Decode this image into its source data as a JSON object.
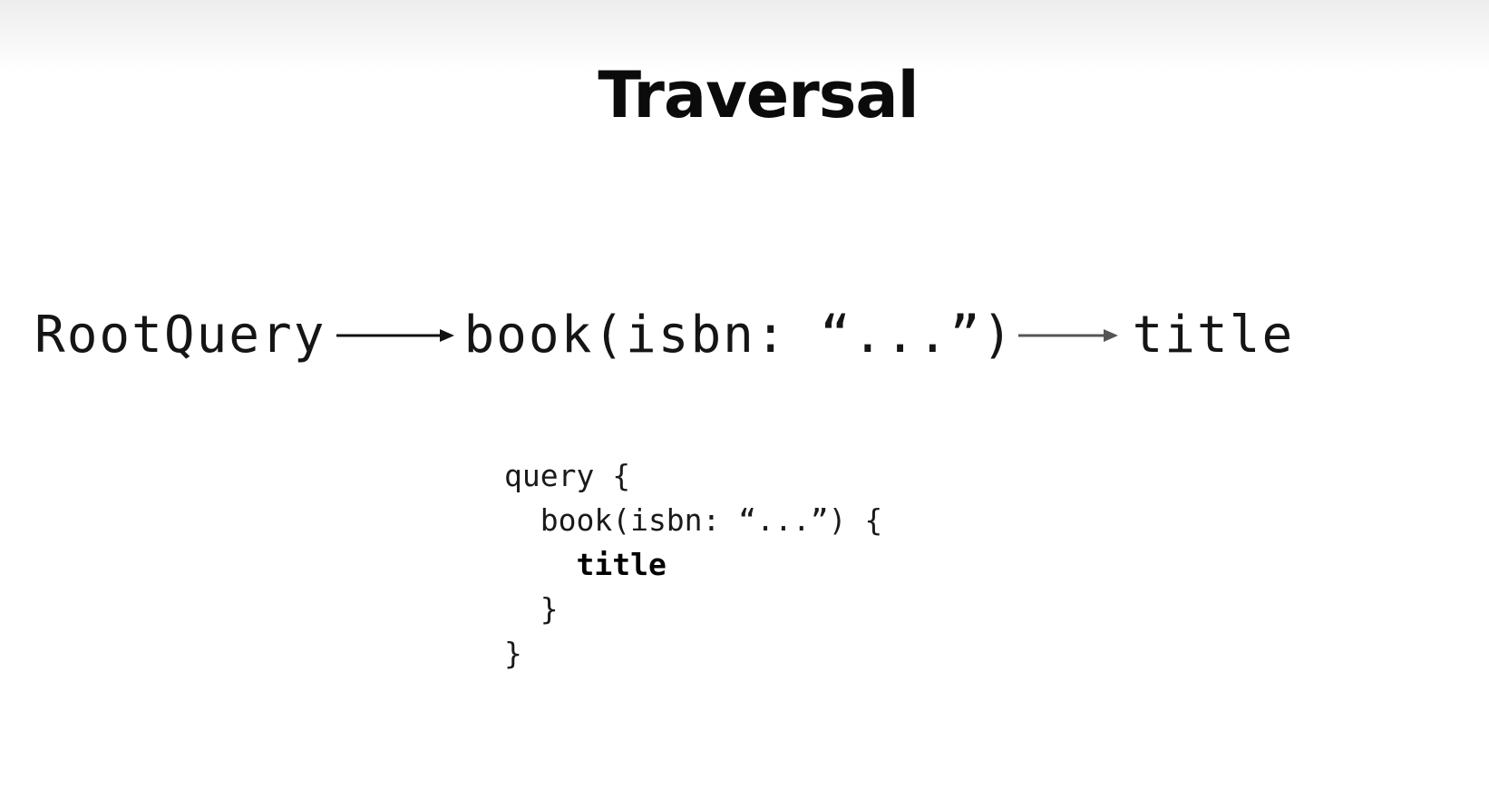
{
  "slide": {
    "title": "Traversal"
  },
  "path": {
    "nodes": [
      "RootQuery",
      "book(isbn: “...”)",
      "title"
    ]
  },
  "code": {
    "line1": "query {",
    "line2": "  book(isbn: “...”) {",
    "line3_indent": "    ",
    "line3_field": "title",
    "line4": "  }",
    "line5": "}"
  }
}
